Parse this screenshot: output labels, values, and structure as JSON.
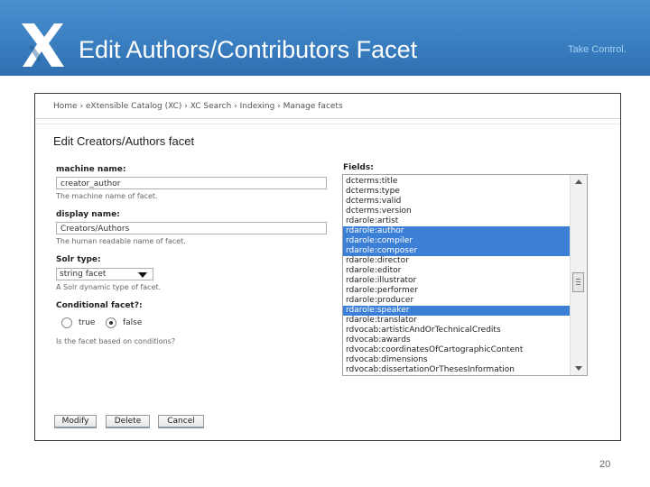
{
  "banner": {
    "title": "Edit Authors/Contributors Facet",
    "tagline": "Take Control.",
    "bg_color": "#3a7fc1"
  },
  "breadcrumb": "Home › eXtensible Catalog (XC) › XC Search › Indexing › Manage facets",
  "form": {
    "title": "Edit Creators/Authors facet",
    "machine_name": {
      "label": "machine name:",
      "value": "creator_author",
      "help": "The machine name of facet."
    },
    "display_name": {
      "label": "display name:",
      "value": "Creators/Authors",
      "help": "The human readable name of facet."
    },
    "solr_type": {
      "label": "Solr type:",
      "value": "string facet",
      "help": "A Solr dynamic type of facet."
    },
    "conditional": {
      "label": "Conditional facet?:",
      "options": [
        "true",
        "false"
      ],
      "selected": "false",
      "help": "Is the facet based on conditions?"
    },
    "fields": {
      "label": "Fields:",
      "items": [
        {
          "text": "dcterms:title",
          "selected": false
        },
        {
          "text": "dcterms:type",
          "selected": false
        },
        {
          "text": "dcterms:valid",
          "selected": false
        },
        {
          "text": "dcterms:version",
          "selected": false
        },
        {
          "text": "rdarole:artist",
          "selected": false
        },
        {
          "text": "rdarole:author",
          "selected": true
        },
        {
          "text": "rdarole:compiler",
          "selected": true
        },
        {
          "text": "rdarole:composer",
          "selected": true
        },
        {
          "text": "rdarole:director",
          "selected": false
        },
        {
          "text": "rdarole:editor",
          "selected": false
        },
        {
          "text": "rdarole:illustrator",
          "selected": false
        },
        {
          "text": "rdarole:performer",
          "selected": false
        },
        {
          "text": "rdarole:producer",
          "selected": false
        },
        {
          "text": "rdarole:speaker",
          "selected": true
        },
        {
          "text": "rdarole:translator",
          "selected": false
        },
        {
          "text": "rdvocab:artisticAndOrTechnicalCredits",
          "selected": false
        },
        {
          "text": "rdvocab:awards",
          "selected": false
        },
        {
          "text": "rdvocab:coordinatesOfCartographicContent",
          "selected": false
        },
        {
          "text": "rdvocab:dimensions",
          "selected": false
        },
        {
          "text": "rdvocab:dissertationOrThesesInformation",
          "selected": false
        }
      ],
      "selection_color": "#3c7fd6"
    }
  },
  "buttons": {
    "modify": "Modify",
    "delete": "Delete",
    "cancel": "Cancel"
  },
  "page_number": "20",
  "icons": [
    "xc-logo-icon",
    "dropdown-arrow-icon",
    "scroll-up-icon",
    "scroll-down-icon",
    "scroll-thumb-grip-icon"
  ]
}
